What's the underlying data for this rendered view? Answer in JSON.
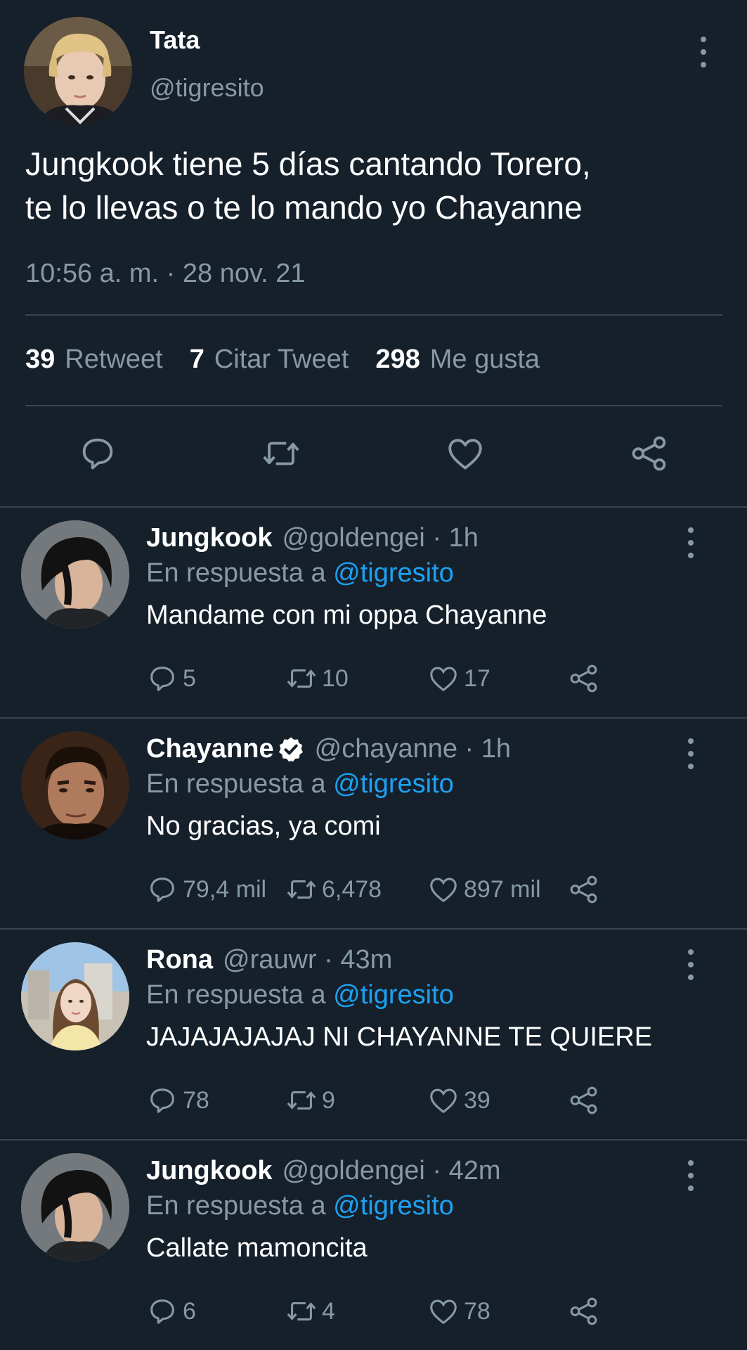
{
  "main_tweet": {
    "name": "Tata",
    "handle": "@tigresito",
    "text": "Jungkook tiene 5 días cantando Torero,\nte lo llevas o te lo mando yo Chayanne",
    "timestamp": "10:56 a. m. · 28 nov. 21",
    "stats": {
      "retweets_count": "39",
      "retweets_label": "Retweet",
      "quotes_count": "7",
      "quotes_label": "Citar Tweet",
      "likes_count": "298",
      "likes_label": "Me gusta"
    },
    "actions": [
      "reply-icon",
      "retweet-icon",
      "like-icon",
      "share-icon"
    ]
  },
  "replies": [
    {
      "name": "Jungkook",
      "verified": false,
      "meta": "@goldengei · 1h",
      "reply_prefix": "En respuesta a",
      "reply_mention": "@tigresito",
      "text": "Mandame con mi oppa Chayanne",
      "replies": "5",
      "retweets": "10",
      "likes": "17"
    },
    {
      "name": "Chayanne",
      "verified": true,
      "meta": "@chayanne · 1h",
      "reply_prefix": "En respuesta a",
      "reply_mention": "@tigresito",
      "text": "No gracias, ya comi",
      "replies": "79,4 mil",
      "retweets": "6,478",
      "likes": "897 mil"
    },
    {
      "name": "Rona",
      "verified": false,
      "meta": "@rauwr · 43m",
      "reply_prefix": "En respuesta a",
      "reply_mention": "@tigresito",
      "text": "JAJAJAJAJAJ NI CHAYANNE TE QUIERE",
      "replies": "78",
      "retweets": "9",
      "likes": "39"
    },
    {
      "name": "Jungkook",
      "verified": false,
      "meta": "@goldengei · 42m",
      "reply_prefix": "En respuesta a",
      "reply_mention": "@tigresito",
      "text": "Callate mamoncita",
      "replies": "6",
      "retweets": "4",
      "likes": "78"
    }
  ],
  "colors": {
    "background": "#15202b",
    "secondary_text": "#8899a6",
    "link": "#1da1f2",
    "divider": "#38444d"
  }
}
